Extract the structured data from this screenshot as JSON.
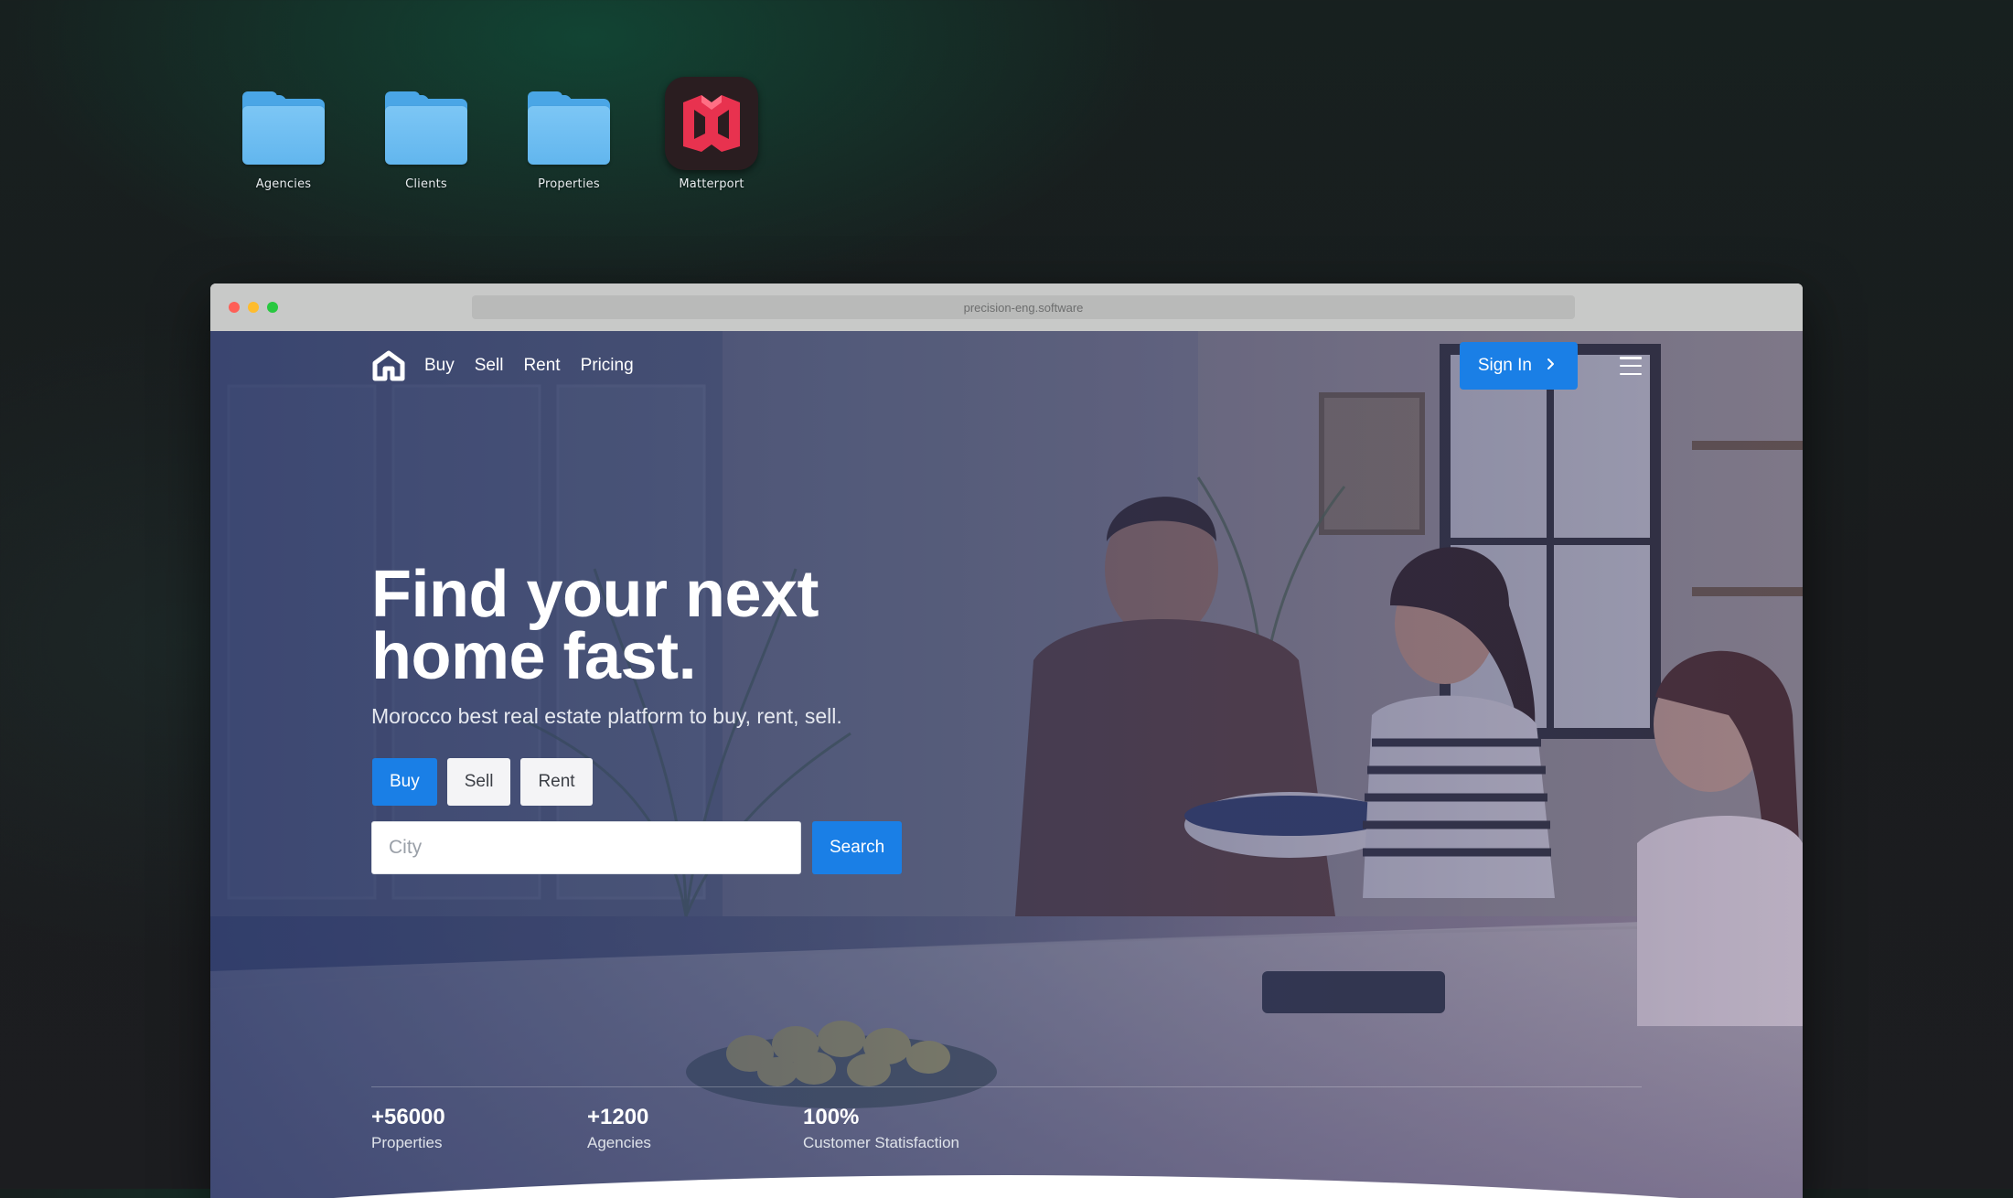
{
  "desktop": {
    "icons": [
      {
        "label": "Agencies",
        "icon": "folder-icon"
      },
      {
        "label": "Clients",
        "icon": "folder-icon"
      },
      {
        "label": "Properties",
        "icon": "folder-icon"
      },
      {
        "label": "Matterport",
        "icon": "matterport-app-icon"
      }
    ]
  },
  "browser": {
    "url": "precision-eng.software"
  },
  "nav": {
    "logo_icon": "home-logo-icon",
    "links": [
      "Buy",
      "Sell",
      "Rent",
      "Pricing"
    ],
    "signin_label": "Sign In",
    "signin_icon": "chevron-right-icon",
    "menu_icon": "hamburger-menu-icon"
  },
  "hero": {
    "headline": "Find your next home fast.",
    "subline": "Morocco best real estate platform to buy, rent, sell.",
    "modes": [
      "Buy",
      "Sell",
      "Rent"
    ],
    "active_mode": "Buy",
    "search": {
      "placeholder": "City",
      "value": "",
      "button_label": "Search"
    }
  },
  "stats": [
    {
      "value": "+56000",
      "label": "Properties"
    },
    {
      "value": "+1200",
      "label": "Agencies"
    },
    {
      "value": "100%",
      "label": "Customer Statisfaction"
    }
  ],
  "colors": {
    "accent": "#1a7fe6",
    "matterport_red": "#e8324f",
    "folder_blue": "#62b6ee"
  }
}
